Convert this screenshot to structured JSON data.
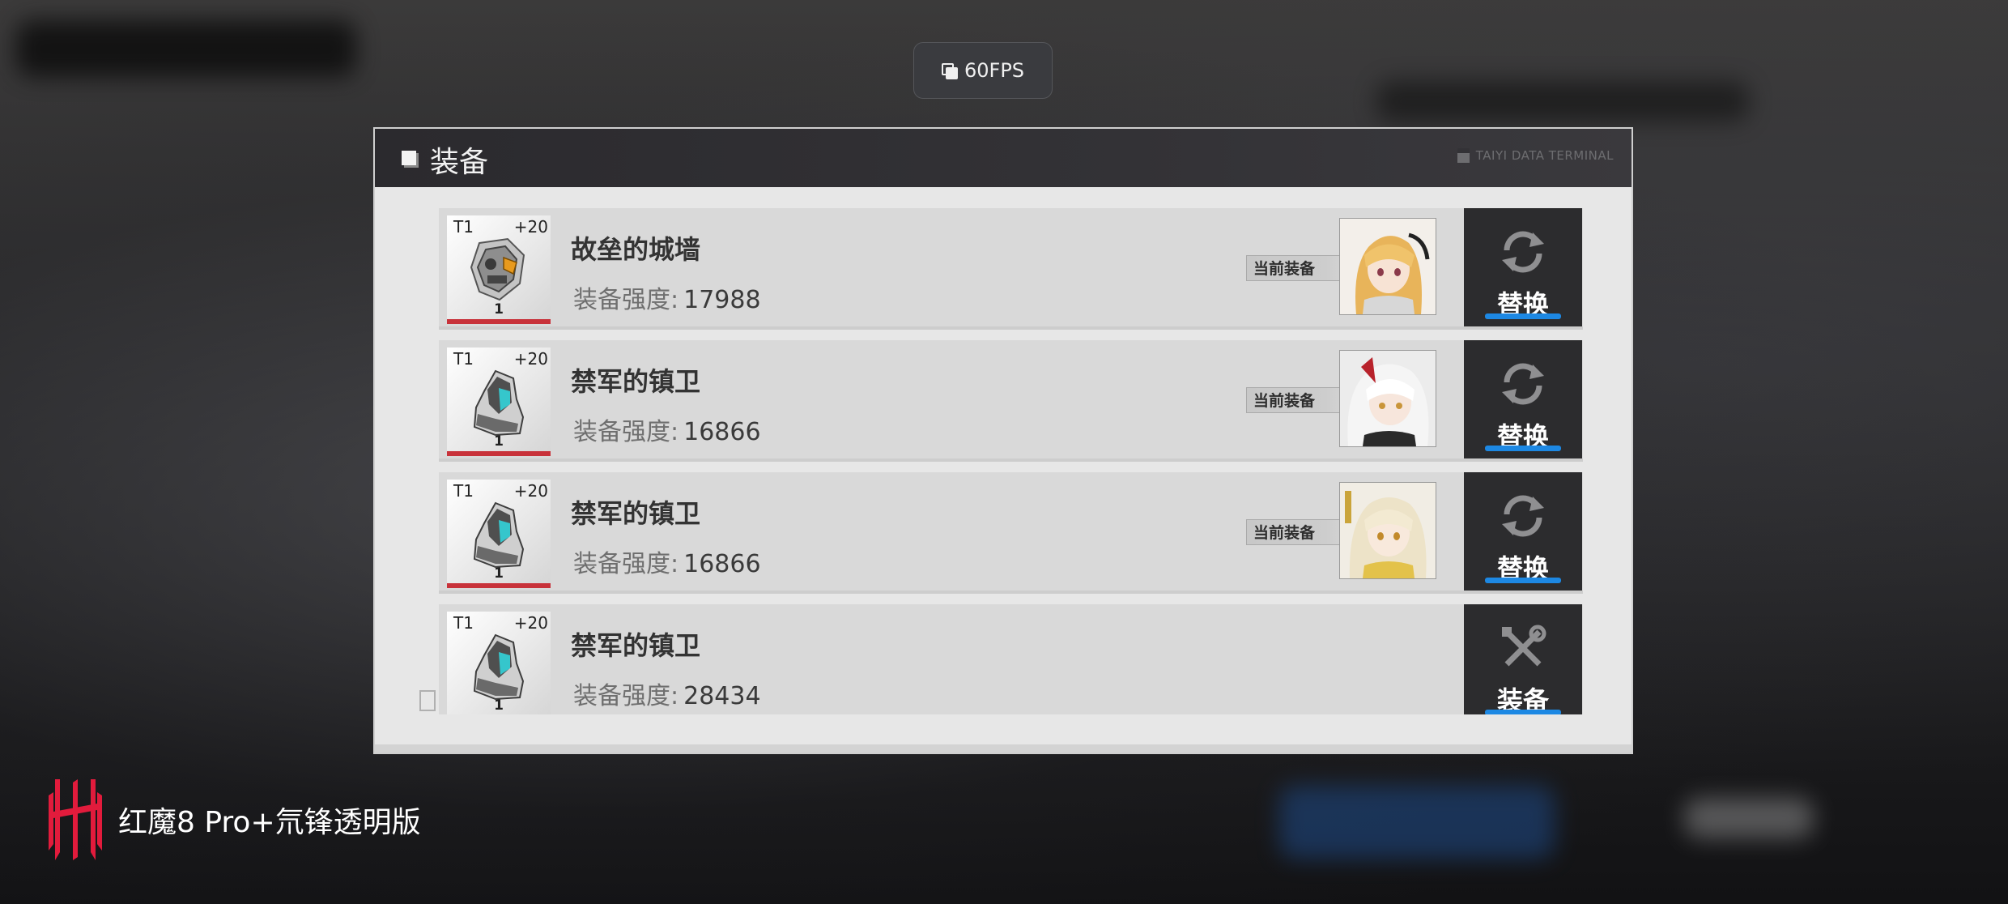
{
  "overlay": {
    "fps_label": "60FPS"
  },
  "panel": {
    "title": "装备",
    "terminal_label": "TAIYI DATA TERMINAL"
  },
  "equipment": [
    {
      "tier": "T1",
      "level": "+20",
      "count": "1",
      "name": "故垒的城墙",
      "stat_label": "装备强度:",
      "stat_value": "17988",
      "equipped_label": "当前装备",
      "portrait": "blonde-character-portrait",
      "action": "替换",
      "action_icon": "refresh-icon"
    },
    {
      "tier": "T1",
      "level": "+20",
      "count": "1",
      "name": "禁军的镇卫",
      "stat_label": "装备强度:",
      "stat_value": "16866",
      "equipped_label": "当前装备",
      "portrait": "white-hair-character-portrait",
      "action": "替换",
      "action_icon": "refresh-icon"
    },
    {
      "tier": "T1",
      "level": "+20",
      "count": "1",
      "name": "禁军的镇卫",
      "stat_label": "装备强度:",
      "stat_value": "16866",
      "equipped_label": "当前装备",
      "portrait": "light-hair-character-portrait",
      "action": "替换",
      "action_icon": "refresh-icon"
    },
    {
      "tier": "T1",
      "level": "+20",
      "count": "1",
      "name": "禁军的镇卫",
      "stat_label": "装备强度:",
      "stat_value": "28434",
      "action": "装备",
      "action_icon": "tools-icon"
    }
  ],
  "brand": {
    "text": "红魔8 Pro+氘锋透明版",
    "logo": "red-magic-logo"
  },
  "colors": {
    "accent_blue": "#1d88e3",
    "rarity_red": "#c8323a",
    "brand_red": "#e21b3c"
  }
}
